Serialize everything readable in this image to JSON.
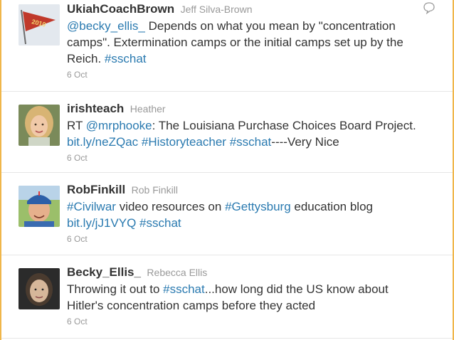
{
  "tweets": [
    {
      "screen_name": "UkiahCoachBrown",
      "full_name": "Jeff Silva-Brown",
      "text_parts": [
        {
          "text": "@becky_ellis_",
          "link": true
        },
        {
          "text": " Depends on what you mean by \"concentration camps\". Extermination camps or the initial camps set up by the Reich. ",
          "link": false
        },
        {
          "text": "#sschat",
          "link": true
        }
      ],
      "time": "6 Oct",
      "avatar_icon": "pennant-flag-avatar-icon",
      "avatar_text": "2010"
    },
    {
      "screen_name": "irishteach",
      "full_name": "Heather",
      "text_parts": [
        {
          "text": "RT ",
          "link": false
        },
        {
          "text": "@mrphooke",
          "link": true
        },
        {
          "text": ": The Louisiana Purchase Choices Board Project. ",
          "link": false
        },
        {
          "text": "bit.ly/neZQac",
          "link": true
        },
        {
          "text": " ",
          "link": false
        },
        {
          "text": "#Historyteacher",
          "link": true
        },
        {
          "text": " ",
          "link": false
        },
        {
          "text": "#sschat",
          "link": true
        },
        {
          "text": "----Very Nice",
          "link": false
        }
      ],
      "time": "6 Oct",
      "avatar_icon": "woman-portrait-avatar-icon"
    },
    {
      "screen_name": "RobFinkill",
      "full_name": "Rob Finkill",
      "text_parts": [
        {
          "text": "#Civilwar",
          "link": true
        },
        {
          "text": " video resources on ",
          "link": false
        },
        {
          "text": "#Gettysburg",
          "link": true
        },
        {
          "text": " education blog ",
          "link": false
        },
        {
          "text": "bit.ly/jJ1VYQ",
          "link": true
        },
        {
          "text": " ",
          "link": false
        },
        {
          "text": "#sschat",
          "link": true
        }
      ],
      "time": "6 Oct",
      "avatar_icon": "man-baseball-cap-avatar-icon"
    },
    {
      "screen_name": "Becky_Ellis_",
      "full_name": "Rebecca Ellis",
      "text_parts": [
        {
          "text": "Throwing it out to ",
          "link": false
        },
        {
          "text": "#sschat",
          "link": true
        },
        {
          "text": "...how long did the US know about Hitler's concentration camps before they acted",
          "link": false
        }
      ],
      "time": "6 Oct",
      "avatar_icon": "woman-portrait-dark-avatar-icon"
    }
  ],
  "colors": {
    "link": "#2a7ab0",
    "name": "#333333",
    "meta": "#999999",
    "frame": "#f0b64a",
    "divider": "#e6e6e6"
  }
}
